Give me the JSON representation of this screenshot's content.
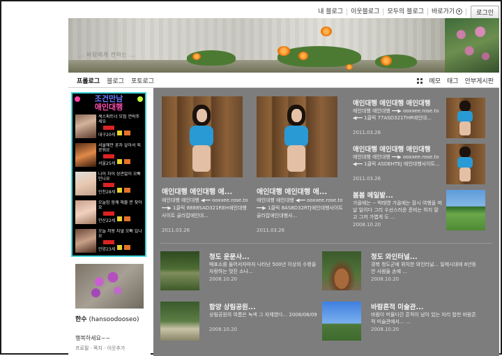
{
  "topbar": {
    "links": [
      "내 블로그",
      "이웃블로그",
      "모두의 블로그",
      "바로가기"
    ],
    "login": "로그인"
  },
  "banner": {
    "text": "... 바람에게 전하는 ..."
  },
  "nav": {
    "left": [
      "프롤로그",
      "블로그",
      "포토로그"
    ],
    "right": [
      "메모",
      "태그",
      "안부게시판"
    ]
  },
  "sidebar": {
    "ad": {
      "title": "조건만남",
      "subtitle": "애인대행",
      "rows": [
        {
          "text": "섹스파트너 모집 연락주세요",
          "meta": "대구20세"
        },
        {
          "text": "서울에만 혼자 살아서 외로워요",
          "meta": "서울25세"
        },
        {
          "text": "나이 차이 상관없이 오빠 만나요",
          "meta": "인천28세"
        },
        {
          "text": "오늘밤 함께 해줄 분 찾아요",
          "meta": "안산22세"
        },
        {
          "text": "오늘 저랑 지낼 오빠 있나요",
          "meta": "안양23세"
        }
      ]
    },
    "profile": {
      "name": "한수",
      "id": "(hansoodooseo)",
      "message": "행복하세요~~",
      "links": [
        "프로필",
        "쪽지",
        "이웃추가"
      ]
    }
  },
  "main": {
    "featured": [
      {
        "title": "애인대행 애인대행 애...",
        "desc": "애인대행 애인대행 ◀━━ ooxxee.rose.to ━━▶ 1클릭 8888SAD321REH애인대행사이트 골라잡애인대...",
        "date": "2011.03.26"
      },
      {
        "title": "애인대행 애인대행 애...",
        "desc": "애인대행 애인대행 ◀━━ ooxxee.rose.to ━━▶ 1클릭 8AS8D32RTJ애인대행사이트 골라잡애인대행사...",
        "date": "2011.03.26"
      }
    ],
    "side_items": [
      {
        "title": "애인대행 애인대행 애인대행",
        "desc": "애인대행 애인대행 ━━▶ ooxxee.rose.to ◀━━ 1클릭 77ASD321THR애인대...",
        "date": "2011.03.26"
      },
      {
        "title": "애인대행 애인대행 애인대행",
        "desc": "애인대행 애인대행 ━━▶ ooxxee.rose.to ◀━━ 1클릭 ASDEHTEJ 애인대행사이트...",
        "date": "2011.03.26"
      },
      {
        "title": "봄봄 메일밭...",
        "desc": "가을에는 -- 박태영 가을에는 잠시 여행을 떠날 일이다 그리 수선스러운 준비는 하지 말고 그저 가볍게 도 ...",
        "date": "2008.10.20"
      }
    ],
    "list": [
      {
        "title": "청도 운문사...",
        "desc": "매표소를 들어서자마자 나타난 500년 이상의 수령을 자랑하는 멋진 소나...",
        "date": "2008.10.20"
      },
      {
        "title": "청도 와인터널...",
        "desc": "경북 청도군에 위치한 와인터널... 일제시대에 8년동안 사람들 손에 ...",
        "date": "2008.10.20"
      },
      {
        "title": "함양 상림공원...",
        "desc": "상림공원의 여름은 녹색 그 자체였다... 2008/08/09",
        "date": "2008.10.20"
      },
      {
        "title": "바람흔적 미술관...",
        "desc": "바람이 머물다간 흔적이 남아 있는 자리 합천 바람흔적 미술관에서... ...",
        "date": "2008.10.20"
      }
    ]
  }
}
